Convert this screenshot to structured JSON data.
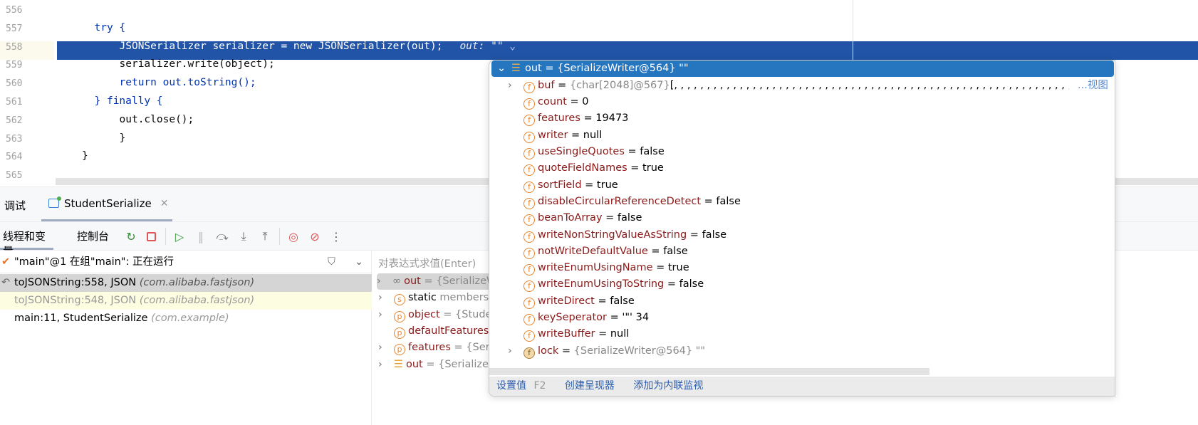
{
  "editor": {
    "lines": [
      {
        "num": "556",
        "code": ""
      },
      {
        "num": "557",
        "code": "try {"
      },
      {
        "num": "558",
        "code": "JSONSerializer serializer = new JSONSerializer(out);",
        "inline_hint": "out: \"\""
      },
      {
        "num": "559",
        "code": "serializer.write(object);"
      },
      {
        "num": "560",
        "code": "return out.toString();"
      },
      {
        "num": "561",
        "code": "} finally {"
      },
      {
        "num": "562",
        "code": "out.close();"
      },
      {
        "num": "563",
        "code": "}"
      },
      {
        "num": "564",
        "code": "}"
      },
      {
        "num": "565",
        "code": ""
      }
    ],
    "highlight_color": "#2154a6"
  },
  "tool_window": {
    "title": "调试",
    "session_tab": "StudentSerialize",
    "tabs": [
      "线程和变量",
      "控制台"
    ],
    "toolbar_icons": [
      "rerun-icon",
      "stop-icon",
      "resume-icon",
      "pause-icon",
      "step-over-icon",
      "step-into-icon",
      "step-out-icon",
      "view-breakpoints-icon",
      "mute-breakpoints-icon",
      "more-icon"
    ]
  },
  "frames": {
    "thread": "\"main\"@1 在组\"main\": 正在运行",
    "items": [
      {
        "method": "toJSONString:558, JSON",
        "pkg": "(com.alibaba.fastjson)"
      },
      {
        "method": "toJSONString:548, JSON",
        "pkg": "(com.alibaba.fastjson)"
      },
      {
        "method": "main:11, StudentSerialize",
        "pkg": "(com.example)"
      }
    ]
  },
  "variables": {
    "eval_placeholder": "对表达式求值(Enter)",
    "items": [
      {
        "icon": "oo",
        "name": "out",
        "value": " = {SerializeW"
      },
      {
        "icon": "s",
        "name": "static",
        "value": " members"
      },
      {
        "icon": "p",
        "name": "object",
        "value": " = {Stude"
      },
      {
        "icon": "p",
        "name": "defaultFeatures",
        "value": ""
      },
      {
        "icon": "p",
        "name": "features",
        "value": " = {Seria"
      },
      {
        "icon": "stack",
        "name": "out",
        "value": " = {SerializeW"
      }
    ]
  },
  "popup": {
    "root": "out = {SerializeWriter@564} \"\"",
    "fields": [
      {
        "name": "buf",
        "value": "{char[2048]@567}",
        "extra": " [, , , , , , , , , , , , , , , , , , , , , , , , , , , , , , , , , , , , , , , , , , , , , , , , , , , , , , , , , , , , , , , , , , , , , , , , , , , , , , , , , , , , , , , , , , , ,",
        "link": "...视图",
        "expandable": true
      },
      {
        "name": "count",
        "value": "0"
      },
      {
        "name": "features",
        "value": "19473"
      },
      {
        "name": "writer",
        "value": "null"
      },
      {
        "name": "useSingleQuotes",
        "value": "false"
      },
      {
        "name": "quoteFieldNames",
        "value": "true"
      },
      {
        "name": "sortField",
        "value": "true"
      },
      {
        "name": "disableCircularReferenceDetect",
        "value": "false"
      },
      {
        "name": "beanToArray",
        "value": "false"
      },
      {
        "name": "writeNonStringValueAsString",
        "value": "false"
      },
      {
        "name": "notWriteDefaultValue",
        "value": "false"
      },
      {
        "name": "writeEnumUsingName",
        "value": "true"
      },
      {
        "name": "writeEnumUsingToString",
        "value": "false"
      },
      {
        "name": "writeDirect",
        "value": "false"
      },
      {
        "name": "keySeperator",
        "value": "'\"' 34"
      },
      {
        "name": "writeBuffer",
        "value": "null"
      },
      {
        "name": "lock",
        "value": "{SerializeWriter@564} \"\"",
        "expandable": true
      }
    ],
    "actions": {
      "set_value": "设置值",
      "set_value_key": "F2",
      "create_renderer": "创建呈现器",
      "add_inline_watch": "添加为内联监视"
    }
  }
}
